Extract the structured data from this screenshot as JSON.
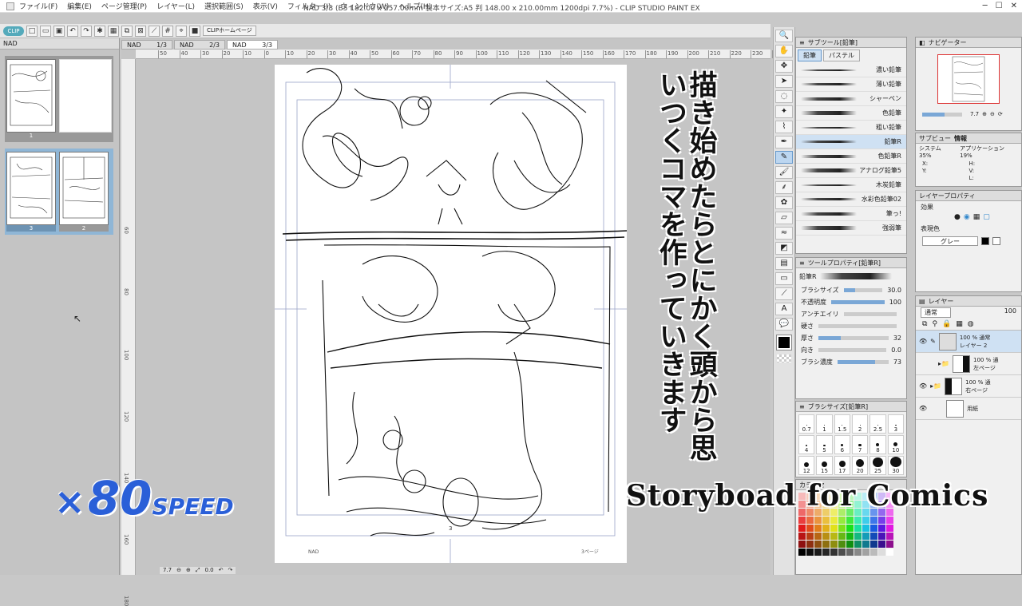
{
  "menu": [
    "ファイル(F)",
    "編集(E)",
    "ページ管理(P)",
    "レイヤー(L)",
    "選択範囲(S)",
    "表示(V)",
    "フィルター(I)",
    "ウィンドウ(W)",
    "ヘルプ(H)"
  ],
  "window_title": "NAD 3/3 (B5 182.00 x 257.00mm 製本サイズ:A5 判 148.00 x 210.00mm 1200dpi 7.7%) - CLIP STUDIO PAINT EX",
  "toolbar": {
    "clip_badge": "CLIP",
    "home_link": "CLIPホームページ"
  },
  "pages_panel": {
    "tab": "NAD",
    "page1_label": "1",
    "page3_label": "3",
    "page2_label": "2"
  },
  "doc_tabs": [
    {
      "name": "NAD",
      "page": "1/3"
    },
    {
      "name": "NAD",
      "page": "2/3"
    },
    {
      "name": "NAD",
      "page": "3/3"
    }
  ],
  "ruler_ticks": [
    "50",
    "40",
    "30",
    "20",
    "10",
    "0",
    "10",
    "20",
    "30",
    "40",
    "50",
    "60",
    "70",
    "80",
    "90",
    "100",
    "110",
    "120",
    "130",
    "140",
    "150",
    "160",
    "170",
    "180",
    "190",
    "200",
    "210",
    "220",
    "230",
    "240"
  ],
  "ruler_v_ticks": [
    "60",
    "80",
    "100",
    "120",
    "140",
    "160",
    "180"
  ],
  "overlay": {
    "vertical_text": "描き始めたらとにかく頭から思いつくコマを作っていきます",
    "speed_x": "×",
    "speed_num": "80",
    "speed_word": "SPEED",
    "storyboard": "Storyboad for Comics"
  },
  "sub_tool": {
    "header": "サブツール[鉛筆]",
    "tabs": [
      "鉛筆",
      "パステル"
    ],
    "brushes": [
      "濃い鉛筆",
      "薄い鉛筆",
      "シャーペン",
      "色鉛筆",
      "粗い鉛筆",
      "鉛筆R",
      "色鉛筆R",
      "アナログ鉛筆5",
      "木炭鉛筆",
      "水彩色鉛筆02",
      "筆っ!",
      "強弱筆"
    ],
    "selected_index": 5
  },
  "tool_property": {
    "header": "ツールプロパティ[鉛筆R]",
    "tool_name": "鉛筆R",
    "rows": [
      {
        "label": "ブラシサイズ",
        "value": "30.0",
        "fill": 0.3
      },
      {
        "label": "不透明度",
        "value": "100",
        "fill": 1.0
      },
      {
        "label": "アンチエイリ",
        "value": "",
        "fill": 0
      },
      {
        "label": "硬さ",
        "value": "",
        "fill": 0
      },
      {
        "label": "厚さ",
        "value": "32",
        "fill": 0.32
      },
      {
        "label": "向き",
        "value": "0.0",
        "fill": 0
      },
      {
        "label": "ブラシ濃度",
        "value": "73",
        "fill": 0.73
      }
    ]
  },
  "brush_size": {
    "header": "ブラシサイズ[鉛筆R]",
    "sizes": [
      "0.7",
      "1",
      "1.5",
      "2",
      "2.5",
      "3",
      "4",
      "5",
      "6",
      "7",
      "8",
      "10",
      "12",
      "15",
      "17",
      "20",
      "25",
      "30"
    ]
  },
  "color_panel": {
    "header": "カラーセ"
  },
  "navigator": {
    "header": "ナビゲーター",
    "zoom": "7.7"
  },
  "sub_view": {
    "tab_sub": "サブビュー",
    "tab_info": "情報",
    "system": "システム 35%",
    "app": "アプリケーション 19%",
    "x": "X:",
    "y": "Y:",
    "h": "H:",
    "v": "V:",
    "l": "L:"
  },
  "layer_property": {
    "header": "レイヤープロパティ",
    "effect": "効果",
    "display_color": "表現色",
    "color_value": "グレー"
  },
  "layers": {
    "header": "レイヤー",
    "blend": "通常",
    "opacity": "100",
    "items": [
      {
        "line1": "100 % 通常",
        "line2": "レイヤー 2"
      },
      {
        "line1": "100 % 通",
        "line2": "左ページ"
      },
      {
        "line1": "100 % 通",
        "line2": "右ページ"
      },
      {
        "line1": "",
        "line2": "用紙"
      }
    ]
  },
  "canvas_footer": {
    "zoom": "7.7",
    "angle": "0.0"
  },
  "paper_marks": {
    "left": "NAD",
    "right": "3ページ",
    "page_no": "3"
  }
}
